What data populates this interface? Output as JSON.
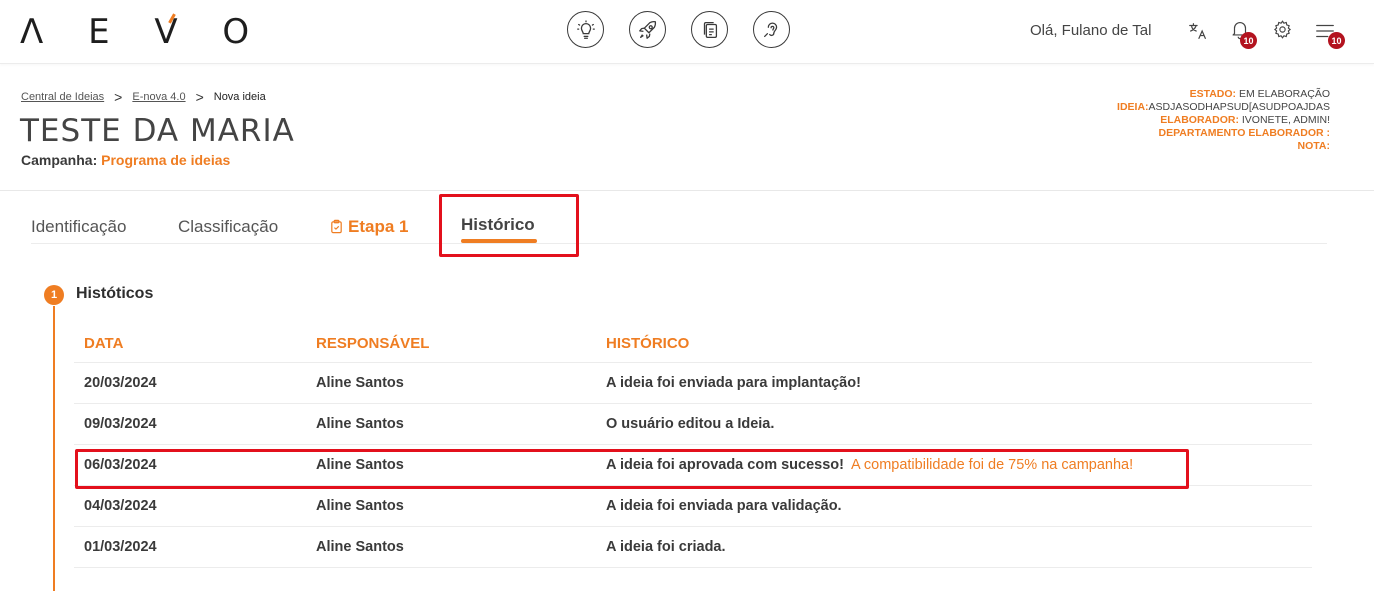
{
  "app": {
    "logo_text": "AEVO",
    "greeting": "Olá, Fulano de Tal",
    "nav_icons": [
      "lightbulb-icon",
      "rocket-icon",
      "copy-icon",
      "ear-icon"
    ],
    "notifications_count": "10",
    "menu_count": "10"
  },
  "breadcrumb": {
    "items": [
      "Central de Ideias",
      "E-nova 4.0"
    ],
    "current": "Nova ideia",
    "separator": ">"
  },
  "header": {
    "title": "TESTE DA MARIA",
    "campaign_label": "Campanha:",
    "campaign_value": "Programa de ideias"
  },
  "meta": {
    "estado_label": "ESTADO:",
    "estado_value": "EM ELABORAÇÃO",
    "ideia_label": "IDEIA:",
    "ideia_value": "ASDJASODHAPSUD[ASUDPOAJDAS",
    "elaborador_label": "ELABORADOR:",
    "elaborador_value": "IVONETE, ADMIN!",
    "departamento_label": "DEPARTAMENTO ELABORADOR :",
    "nota_label": "NOTA:"
  },
  "tabs": [
    {
      "label": "Identificação"
    },
    {
      "label": "Classificação"
    },
    {
      "label": "Etapa 1"
    },
    {
      "label": "Histórico"
    }
  ],
  "section": {
    "step": "1",
    "title": "Históticos"
  },
  "table": {
    "headers": [
      "DATA",
      "RESPONSÁVEL",
      "HISTÓRICO"
    ],
    "rows": [
      {
        "data": "20/03/2024",
        "responsavel": "Aline Santos",
        "historico": "A ideia foi enviada para implantação!",
        "extra": ""
      },
      {
        "data": "09/03/2024",
        "responsavel": "Aline Santos",
        "historico": "O usuário editou a Ideia.",
        "extra": ""
      },
      {
        "data": "06/03/2024",
        "responsavel": "Aline Santos",
        "historico": "A ideia foi aprovada com sucesso!",
        "extra": "A compatibilidade foi de 75% na campanha!"
      },
      {
        "data": "04/03/2024",
        "responsavel": "Aline Santos",
        "historico": "A ideia foi enviada para validação.",
        "extra": ""
      },
      {
        "data": "01/03/2024",
        "responsavel": "Aline Santos",
        "historico": "A ideia foi criada.",
        "extra": ""
      }
    ]
  },
  "colors": {
    "accent": "#ef7d22",
    "highlight": "#e3101c",
    "badge": "#b3131f"
  }
}
